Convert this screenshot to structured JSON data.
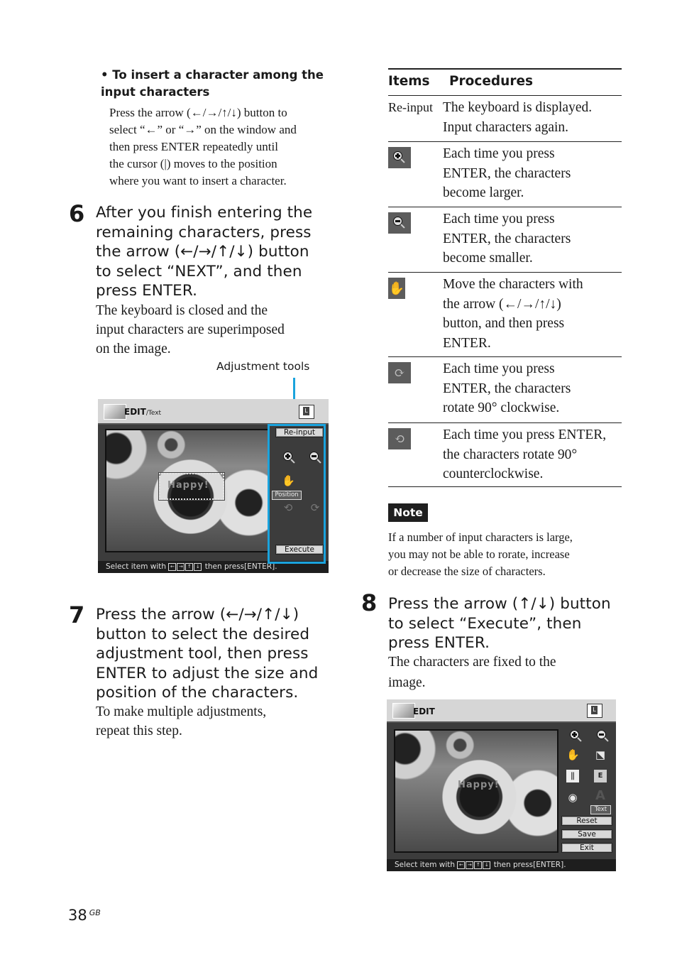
{
  "bullet": {
    "marker": "•",
    "title": "To insert a character among the input characters",
    "lines": [
      "Press the arrow  (←/→/↑/↓) button to",
      "select “←” or “→” on the window and",
      "then press ENTER repeatedly until",
      "the cursor (|) moves to the position",
      "where you want to insert a character."
    ]
  },
  "step6": {
    "number": "6",
    "title_lines": [
      "After you finish entering the",
      "remaining characters, press",
      "the arrow (←/→/↑/↓) button",
      "to select “NEXT”, and then",
      "press ENTER."
    ],
    "body_lines": [
      "The keyboard is closed and the",
      "input characters are superimposed",
      "on the image."
    ],
    "callout": "Adjustment tools"
  },
  "screen1": {
    "title": "EDIT",
    "subtitle": "∕Text",
    "layout_icon": "L",
    "overlay_text": "Happy!",
    "buttons": {
      "reinput": "Re-input",
      "execute": "Execute"
    },
    "position_tag": "Position",
    "tools": [
      "zoom-in-icon",
      "zoom-out-icon",
      "hand-icon",
      "rotate-ccw-icon",
      "rotate-cw-icon"
    ],
    "status": {
      "prefix": "Select item with",
      "suffix": "then press",
      "key": "[ENTER]",
      "end": "."
    }
  },
  "step7": {
    "number": "7",
    "title_lines": [
      "Press the arrow (←/→/↑/↓)",
      "button to select the desired",
      "adjustment tool, then press",
      "ENTER to adjust the size and",
      "position of the characters."
    ],
    "body_lines": [
      "To make multiple adjustments,",
      "repeat this step."
    ]
  },
  "table": {
    "headers": {
      "items": "Items",
      "procedures": "Procedures"
    },
    "rows": [
      {
        "item": "Re-input",
        "icon": null,
        "lines": [
          "The keyboard is displayed.",
          "Input characters again."
        ]
      },
      {
        "item": null,
        "icon": "zoom-in-icon",
        "lines": [
          "Each time you press",
          "ENTER, the characters",
          "become larger."
        ]
      },
      {
        "item": null,
        "icon": "zoom-out-icon",
        "lines": [
          "Each time you press",
          "ENTER, the characters",
          "become smaller."
        ]
      },
      {
        "item": null,
        "icon": "hand-icon",
        "lines": [
          "Move the characters with",
          "the arrow (←/→/↑/↓)",
          "button, and then press",
          "ENTER."
        ]
      },
      {
        "item": null,
        "icon": "rotate-cw-icon",
        "lines": [
          "Each time you press",
          "ENTER, the characters",
          "rotate 90° clockwise."
        ]
      },
      {
        "item": null,
        "icon": "rotate-ccw-icon",
        "lines": [
          "Each time you press ENTER,",
          "the characters rotate 90°",
          "counterclockwise."
        ]
      }
    ]
  },
  "note": {
    "label": "Note",
    "lines": [
      "If a number of input characters is large,",
      "you may not be able to rorate, increase",
      "or decrease the size of characters."
    ]
  },
  "step8": {
    "number": "8",
    "title_lines": [
      "Press the arrow (↑/↓) button",
      "to select  “Execute”, then",
      "press ENTER."
    ],
    "body_lines": [
      "The characters are fixed to the",
      "image."
    ]
  },
  "screen2": {
    "title": "EDIT",
    "layout_icon": "L",
    "overlay_text": "Happy!",
    "text_tag": "Text",
    "buttons": {
      "reset": "Reset",
      "save": "Save",
      "exit": "Exit"
    },
    "tools": [
      "zoom-in-icon",
      "zoom-out-icon",
      "hand-icon",
      "crop-icon",
      "sliders-icon",
      "frame-icon",
      "red-eye-icon",
      "text-icon"
    ],
    "status": {
      "prefix": "Select item with",
      "suffix": "then press",
      "key": "[ENTER]",
      "end": "."
    }
  },
  "footer": {
    "page": "38",
    "region": "GB"
  },
  "colors": {
    "accent": "#1aa3dd",
    "note_bg": "#1f1f1f"
  }
}
